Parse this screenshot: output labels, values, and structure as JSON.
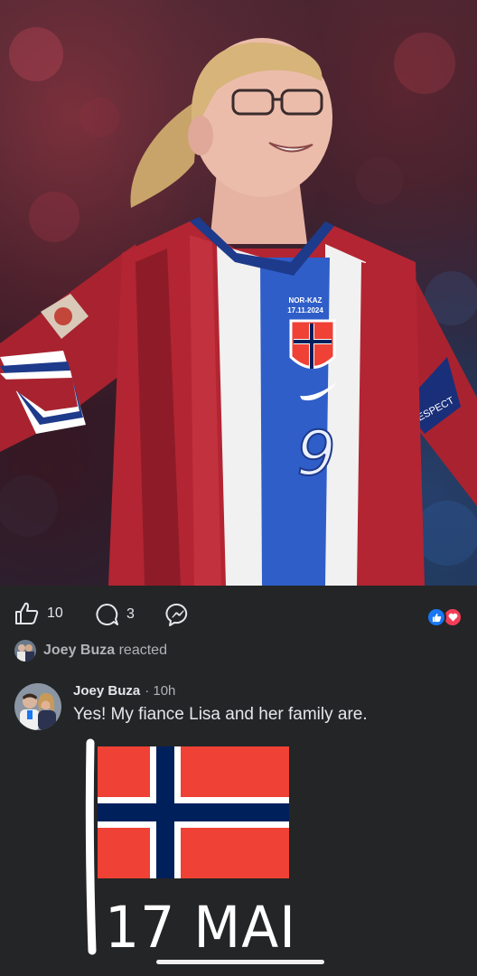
{
  "post": {
    "jersey_text_line1": "NOR-KAZ",
    "jersey_text_line2": "17.11.2024",
    "jersey_number": "9",
    "armband_text": "RESPECT"
  },
  "actions": {
    "like_count": "10",
    "comment_count": "3"
  },
  "reacted": {
    "name": "Joey Buza",
    "suffix": "reacted"
  },
  "comment": {
    "author": "Joey Buza",
    "meta": "· 10h",
    "text": "Yes! My fiance Lisa and her family are."
  },
  "drawing": {
    "label": "17 MAI"
  },
  "colors": {
    "background": "#242526",
    "like_blue": "#1877f2",
    "love_red": "#f33e58",
    "flag_red": "#ef4135",
    "flag_blue": "#00205b"
  }
}
